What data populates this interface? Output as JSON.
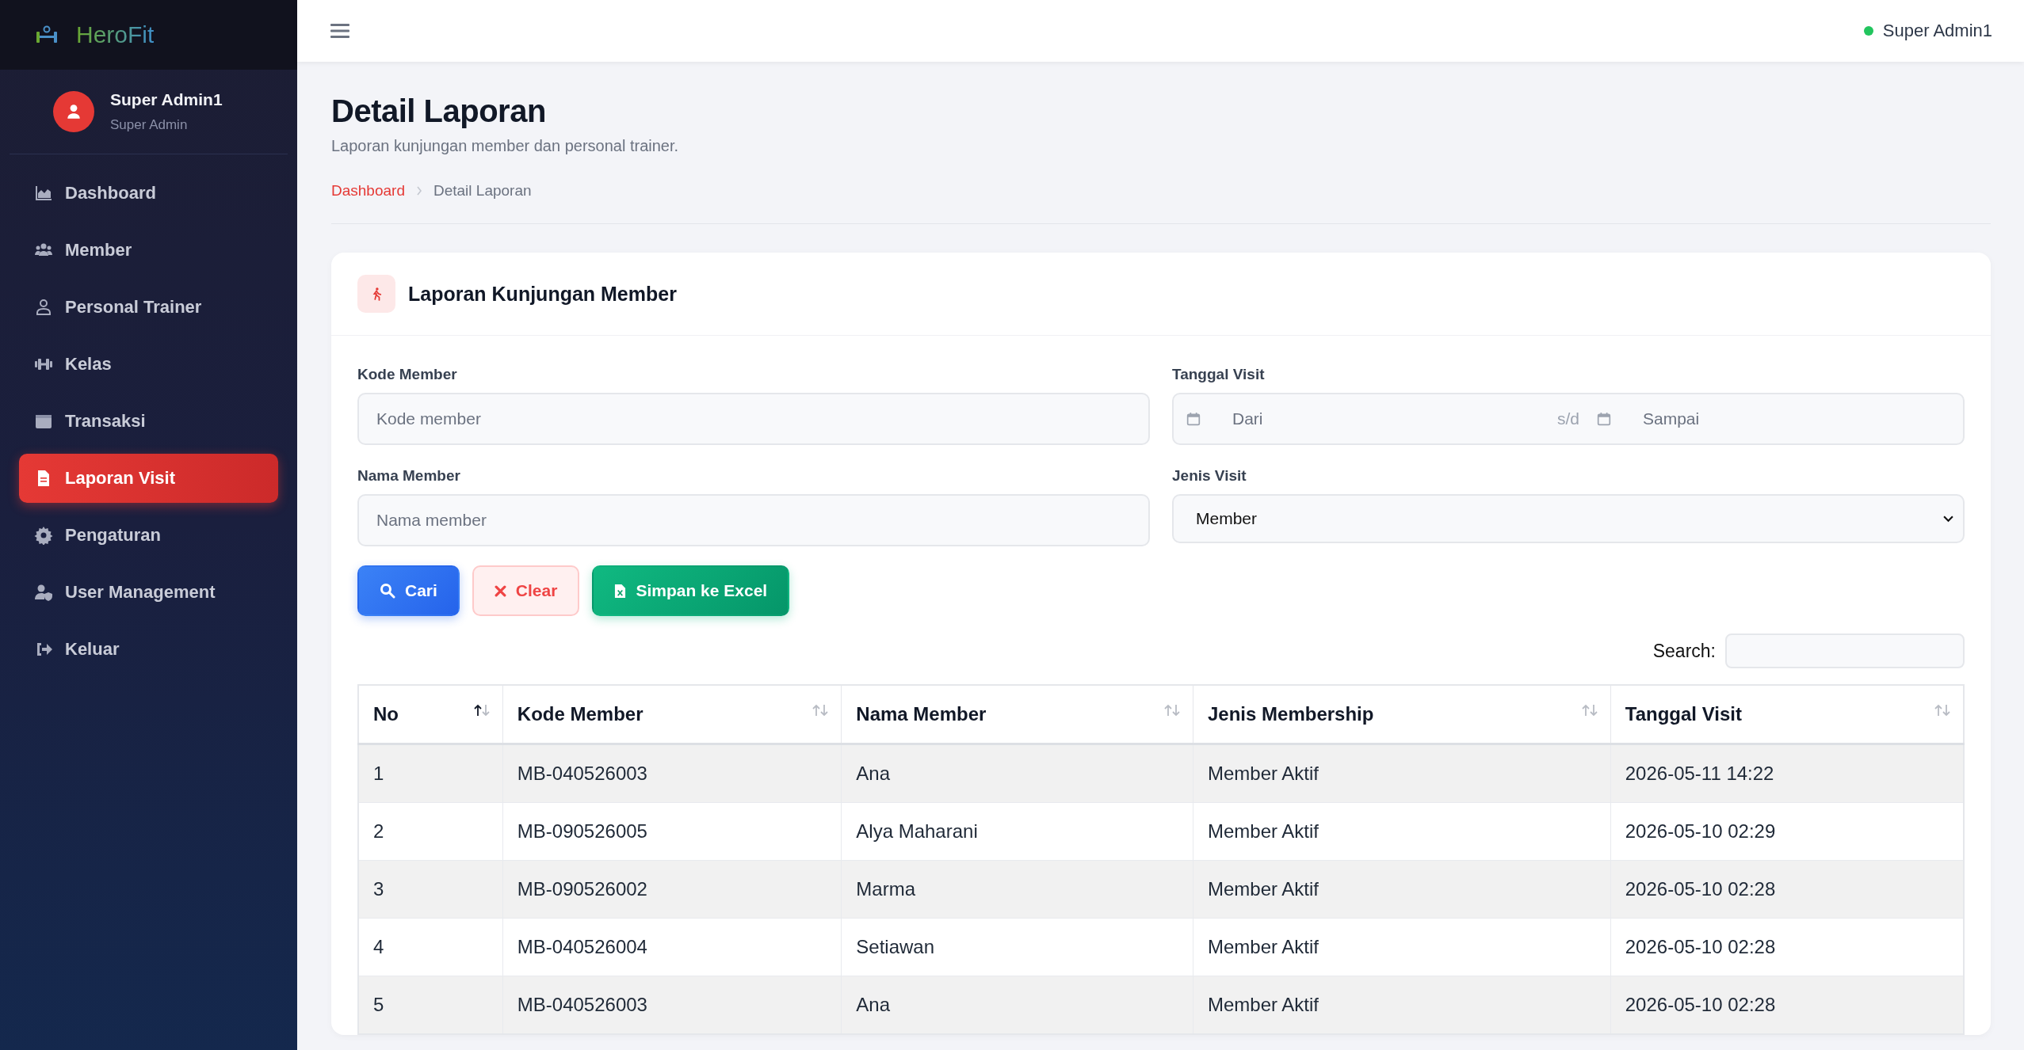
{
  "sidebar": {
    "brand": "HeroFit",
    "profile": {
      "name": "Super Admin1",
      "role": "Super Admin"
    },
    "items": [
      {
        "label": "Dashboard",
        "selected": false
      },
      {
        "label": "Member",
        "selected": false
      },
      {
        "label": "Personal Trainer",
        "selected": false
      },
      {
        "label": "Kelas",
        "selected": false
      },
      {
        "label": "Transaksi",
        "selected": false
      },
      {
        "label": "Laporan Visit",
        "selected": true
      },
      {
        "label": "Pengaturan",
        "selected": false
      },
      {
        "label": "User Management",
        "selected": false
      },
      {
        "label": "Keluar",
        "selected": false
      }
    ]
  },
  "topbar": {
    "user": "Super Admin1",
    "online": true
  },
  "page": {
    "title": "Detail Laporan",
    "subtitle": "Laporan kunjungan member dan personal trainer.",
    "breadcrumb": [
      {
        "label": "Dashboard",
        "kind": "link"
      },
      {
        "label": "Detail Laporan",
        "kind": "current"
      }
    ]
  },
  "card": {
    "title": "Laporan Kunjungan Member",
    "filters": {
      "kode_member": {
        "label": "Kode Member",
        "placeholder": "Kode member"
      },
      "tanggal_visit": {
        "label": "Tanggal Visit",
        "from_placeholder": "Dari",
        "separator": "s/d",
        "to_placeholder": "Sampai"
      },
      "nama_member": {
        "label": "Nama Member",
        "placeholder": "Nama member"
      },
      "jenis_visit": {
        "label": "Jenis Visit",
        "value": "Member"
      }
    },
    "buttons": [
      {
        "label": "Cari",
        "kind": "search"
      },
      {
        "label": "Clear",
        "kind": "clear"
      },
      {
        "label": "Simpan ke Excel",
        "kind": "excel"
      }
    ],
    "search": {
      "label": "Search:"
    },
    "table": {
      "columns": [
        {
          "label": "No",
          "sorted": true
        },
        {
          "label": "Kode Member",
          "sorted": false
        },
        {
          "label": "Nama Member",
          "sorted": false
        },
        {
          "label": "Jenis Membership",
          "sorted": false
        },
        {
          "label": "Tanggal Visit",
          "sorted": false
        }
      ],
      "rows": [
        [
          "1",
          "MB-040526003",
          "Ana",
          "Member Aktif",
          "2026-05-11 14:22"
        ],
        [
          "2",
          "MB-090526005",
          "Alya Maharani",
          "Member Aktif",
          "2026-05-10 02:29"
        ],
        [
          "3",
          "MB-090526002",
          "Marma",
          "Member Aktif",
          "2026-05-10 02:28"
        ],
        [
          "4",
          "MB-040526004",
          "Setiawan",
          "Member Aktif",
          "2026-05-10 02:28"
        ],
        [
          "5",
          "MB-040526003",
          "Ana",
          "Member Aktif",
          "2026-05-10 02:28"
        ]
      ]
    }
  }
}
